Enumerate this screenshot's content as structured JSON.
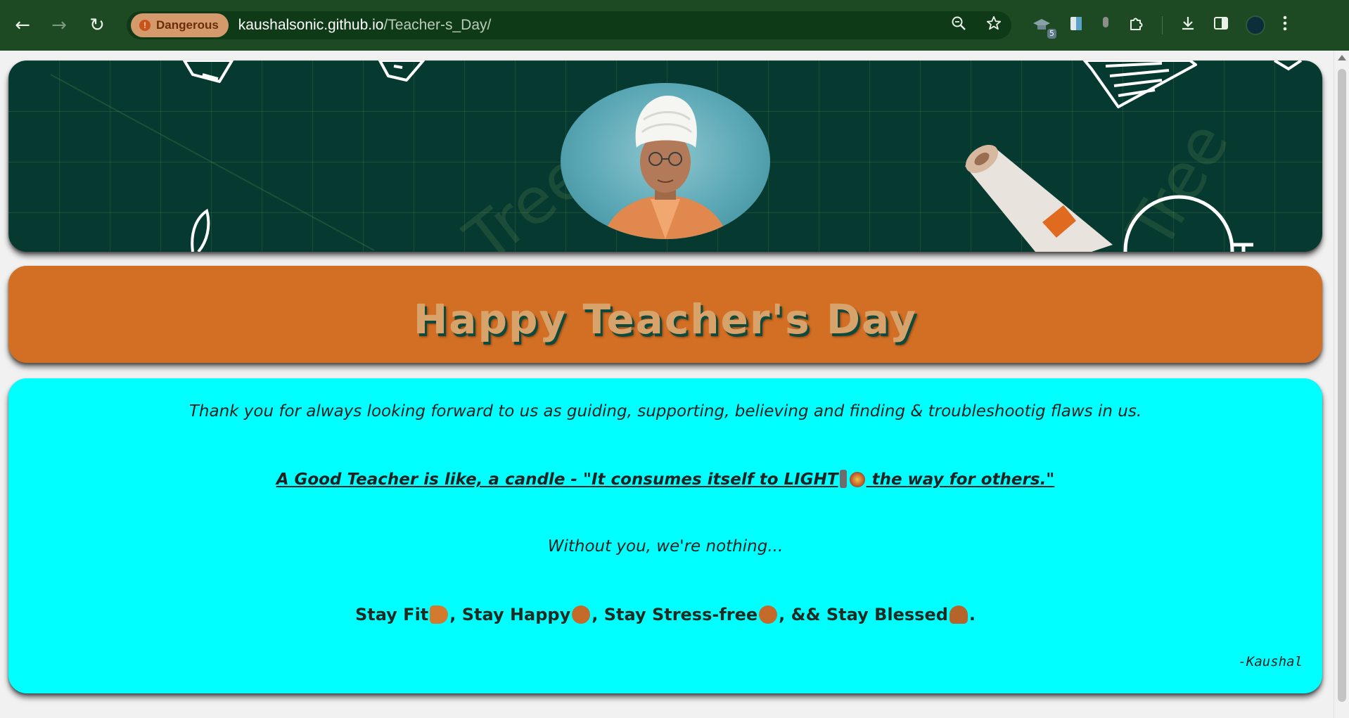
{
  "browser": {
    "security_chip": "Dangerous",
    "url_host": "kaushalsonic.github.io",
    "url_path": "/Teacher-s_Day/",
    "extension_count": "5",
    "icons": {
      "back": "arrow-left-icon",
      "forward": "arrow-right-icon",
      "reload": "reload-icon",
      "zoom": "zoom-icon",
      "bookmark": "star-icon",
      "extensions": "puzzle-icon",
      "download": "download-icon",
      "sidepanel": "side-panel-icon",
      "menu": "kebab-menu-icon"
    },
    "colors": {
      "chrome": "#1d4a22",
      "danger_chip": "#d59a6b"
    }
  },
  "page": {
    "title": "Happy Teacher's Day",
    "message_line1": "Thank you for always looking forward to us as guiding, supporting, believing and finding & troubleshootig flaws in us.",
    "quote_part1": "A Good Teacher is like, a candle - \"It consumes itself to LIGHT",
    "quote_part2": " the way for others.\"",
    "message_line3": "Without you, we're nothing...",
    "wish_1": "Stay Fit",
    "wish_2": ", Stay Happy",
    "wish_3": ", Stay Stress-free",
    "wish_4": ", && Stay Blessed",
    "wish_end": ".",
    "signature": "-Kaushal",
    "colors": {
      "banner_bg": "#063a30",
      "title_card": "#d36f25",
      "title_text": "#d8a36b",
      "message_card": "#00ffff"
    }
  }
}
